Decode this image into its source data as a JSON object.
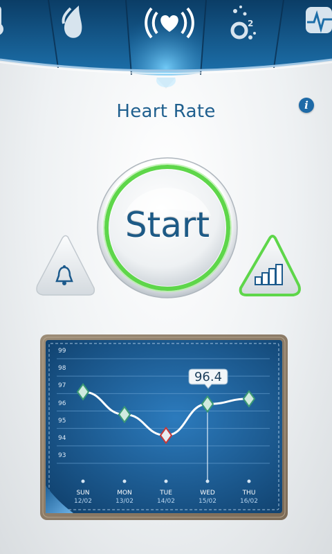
{
  "header": {
    "title": "Heart Rate",
    "icons": [
      "thermometer-icon",
      "drop-icon",
      "heart-rate-icon",
      "oxygen-icon",
      "ecg-icon"
    ],
    "active_icon": "heart-rate-icon",
    "accent_color": "#1e6aa7"
  },
  "info_label": "i",
  "start": {
    "label": "Start",
    "ring_color": "#5ed64a"
  },
  "chart_data": {
    "type": "line",
    "x": [
      "SUN",
      "MON",
      "TUE",
      "WED",
      "THU"
    ],
    "dates": [
      "12/02",
      "13/02",
      "14/02",
      "15/02",
      "16/02"
    ],
    "values": [
      97.1,
      95.8,
      94.6,
      96.4,
      96.7
    ],
    "y_ticks": [
      "99",
      "98",
      "97",
      "96",
      "95",
      "94",
      "93"
    ],
    "ylim": [
      93,
      99
    ],
    "highlight_index": 3,
    "highlight_label": "96.4",
    "min_index": 2,
    "grid": true
  }
}
